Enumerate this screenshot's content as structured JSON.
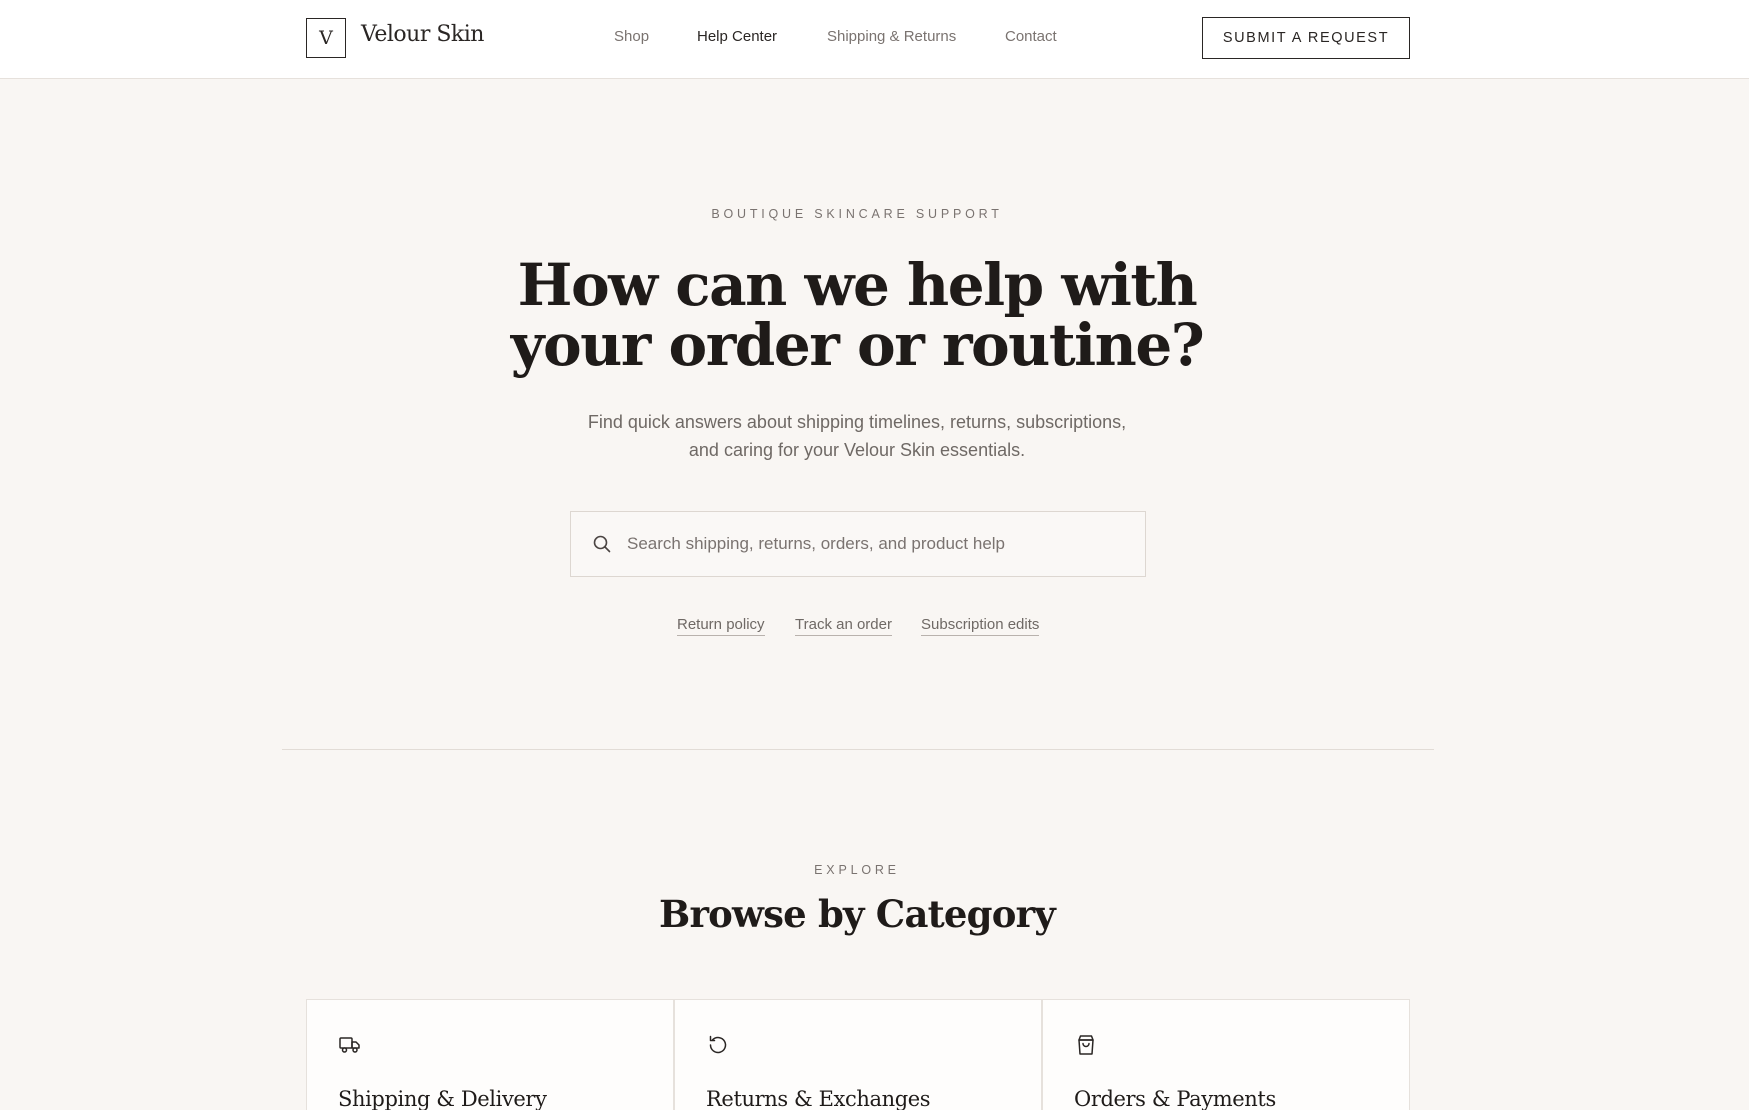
{
  "brand": {
    "logo_letter": "V",
    "name": "Velour Skin"
  },
  "nav": {
    "items": [
      {
        "label": "Shop",
        "active": false
      },
      {
        "label": "Help Center",
        "active": true
      },
      {
        "label": "Shipping & Returns",
        "active": false
      },
      {
        "label": "Contact",
        "active": false
      }
    ],
    "cta_label": "SUBMIT A REQUEST"
  },
  "hero": {
    "eyebrow": "BOUTIQUE SKINCARE SUPPORT",
    "title_line1": "How can we help with",
    "title_line2": "your order or routine?",
    "subtitle_line1": "Find quick answers about shipping timelines, returns, subscriptions,",
    "subtitle_line2": "and caring for your Velour Skin essentials.",
    "search_placeholder": "Search shipping, returns, orders, and product help",
    "search_icon": "search-icon",
    "quick_links": [
      "Return policy",
      "Track an order",
      "Subscription edits"
    ]
  },
  "categories": {
    "eyebrow": "EXPLORE",
    "title": "Browse by Category",
    "items": [
      {
        "title": "Shipping & Delivery",
        "icon": "truck-icon"
      },
      {
        "title": "Returns & Exchanges",
        "icon": "return-arrow-icon"
      },
      {
        "title": "Orders & Payments",
        "icon": "shopping-bag-icon"
      }
    ]
  },
  "colors": {
    "page_background": "#f9f6f3",
    "header_background": "#ffffff",
    "text_primary": "#1f1b19",
    "text_muted": "#7a7370",
    "border": "#e6e1dc"
  }
}
